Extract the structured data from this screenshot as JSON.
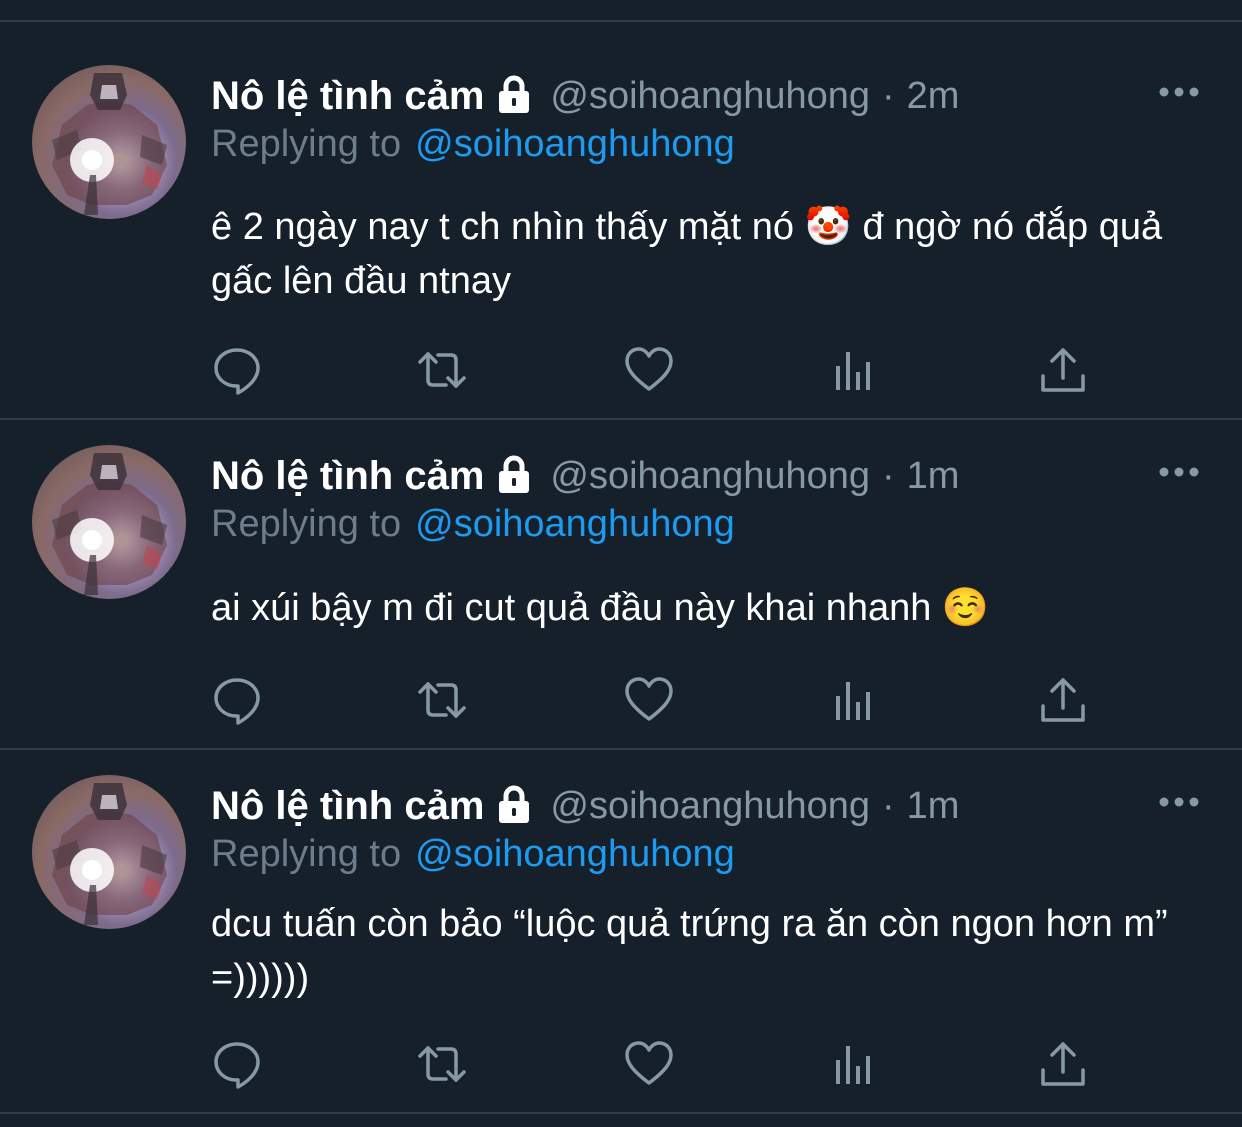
{
  "tweets": [
    {
      "display_name": "Nô lệ tình cảm",
      "handle": "@soihoanghuhong",
      "separator": "·",
      "time": "2m",
      "reply_prefix": "Replying to",
      "reply_handle": "@soihoanghuhong",
      "text": "ê 2 ngày nay t ch nhìn thấy mặt nó 🤡 đ ngờ nó đắp quả gấc lên đầu ntnay"
    },
    {
      "display_name": "Nô lệ tình cảm",
      "handle": "@soihoanghuhong",
      "separator": "·",
      "time": "1m",
      "reply_prefix": "Replying to",
      "reply_handle": "@soihoanghuhong",
      "text": "ai xúi bậy m đi cut quả đầu này khai nhanh ☺️"
    },
    {
      "display_name": "Nô lệ tình cảm",
      "handle": "@soihoanghuhong",
      "separator": "·",
      "time": "1m",
      "reply_prefix": "Replying to",
      "reply_handle": "@soihoanghuhong",
      "text": "dcu tuấn còn bảo “luộc quả trứng ra ăn còn ngon hơn m” =))))))"
    }
  ],
  "icons": {
    "lock": "lock-icon",
    "more": "more-icon",
    "reply": "reply-icon",
    "retweet": "retweet-icon",
    "like": "like-icon",
    "analytics": "analytics-icon",
    "share": "share-icon"
  },
  "colors": {
    "background": "#15202b",
    "divider": "#2f3c4a",
    "secondary_text": "#8899a6",
    "link": "#1d9bf0",
    "icon": "#8899a6"
  }
}
